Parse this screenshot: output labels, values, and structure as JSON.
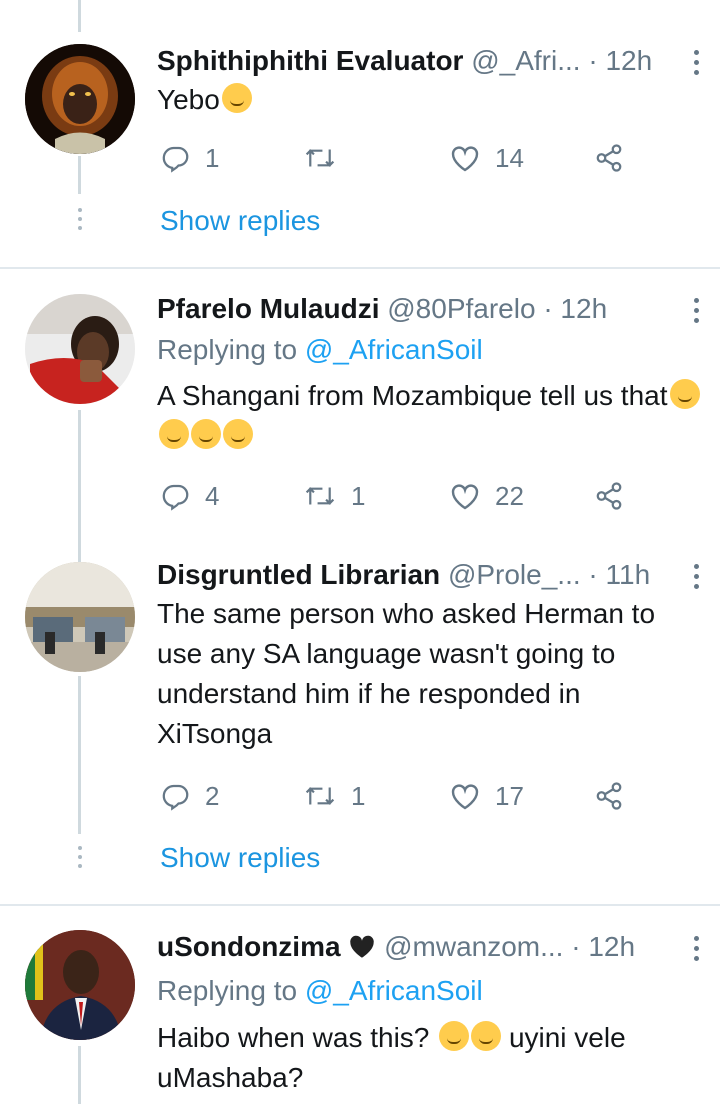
{
  "tweets": [
    {
      "name": "Sphithiphithi Evaluator",
      "handle": "@_Afri...",
      "time": "· 12h",
      "replying_prefix": "",
      "replying_handle": "",
      "text": "Yebo",
      "replies": "1",
      "retweets": "",
      "likes": "14",
      "show_replies": "Show replies"
    },
    {
      "name": "Pfarelo Mulaudzi",
      "handle": "@80Pfarelo",
      "time": "· 12h",
      "replying_prefix": "Replying to ",
      "replying_handle": "@_AfricanSoil",
      "text": "A Shangani from Mozambique tell us that",
      "replies": "4",
      "retweets": "1",
      "likes": "22",
      "show_replies": ""
    },
    {
      "name": "Disgruntled Librarian",
      "handle": "@Prole_...",
      "time": "· 11h",
      "replying_prefix": "",
      "replying_handle": "",
      "text": "The same person who asked Herman to use any SA language wasn't going to understand him if he responded in XiTsonga",
      "replies": "2",
      "retweets": "1",
      "likes": "17",
      "show_replies": "Show replies"
    },
    {
      "name": "uSondonzima",
      "handle": "@mwanzom...",
      "time": "· 12h",
      "replying_prefix": "Replying to ",
      "replying_handle": "@_AfricanSoil",
      "text_a": "Haibo when was this?",
      "text_b": "uyini vele uMashaba?",
      "replies": "",
      "retweets": "",
      "likes": "",
      "show_replies": ""
    }
  ],
  "icons": {
    "reply": "reply-icon",
    "retweet": "retweet-icon",
    "like": "heart-icon",
    "share": "share-icon",
    "more": "more-vertical-icon"
  },
  "colors": {
    "link": "#1b95e0",
    "secondary": "#657786",
    "separator": "#e1e8ed",
    "thread_line": "#cfd9de"
  }
}
